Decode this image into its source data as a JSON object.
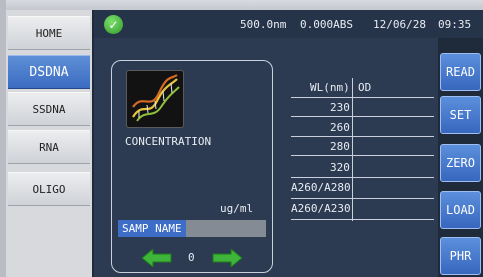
{
  "nav": {
    "items": [
      {
        "label": "HOME",
        "active": false
      },
      {
        "label": "DSDNA",
        "active": true
      },
      {
        "label": "SSDNA",
        "active": false
      },
      {
        "label": "RNA",
        "active": false
      },
      {
        "label": "OLIGO",
        "active": false
      }
    ]
  },
  "status": {
    "wavelength": "500.0nm",
    "absorbance": "0.000ABS",
    "date": "12/06/28",
    "time": "09:35",
    "ok_icon": "check-circle-icon"
  },
  "sample": {
    "icon": "dna-helix-icon",
    "mode_label": "CONCENTRATION",
    "unit": "ug/ml",
    "name_label": "SAMP NAME",
    "index": "0",
    "prev_icon": "arrow-left-icon",
    "next_icon": "arrow-right-icon"
  },
  "results_table": {
    "headers": [
      "WL(nm)",
      "OD"
    ],
    "rows": [
      {
        "wl": "230",
        "od": ""
      },
      {
        "wl": "260",
        "od": ""
      },
      {
        "wl": "280",
        "od": ""
      },
      {
        "wl": "320",
        "od": ""
      },
      {
        "wl": "A260/A280",
        "od": ""
      },
      {
        "wl": "A260/A230",
        "od": ""
      }
    ]
  },
  "actions": {
    "read": "READ",
    "set": "SET",
    "zero": "ZERO",
    "load": "LOAD",
    "phr": "PHR"
  },
  "colors": {
    "accent": "#3c6cc2",
    "ok_green": "#2f9a2b",
    "arrow_green": "#3fb43a"
  }
}
